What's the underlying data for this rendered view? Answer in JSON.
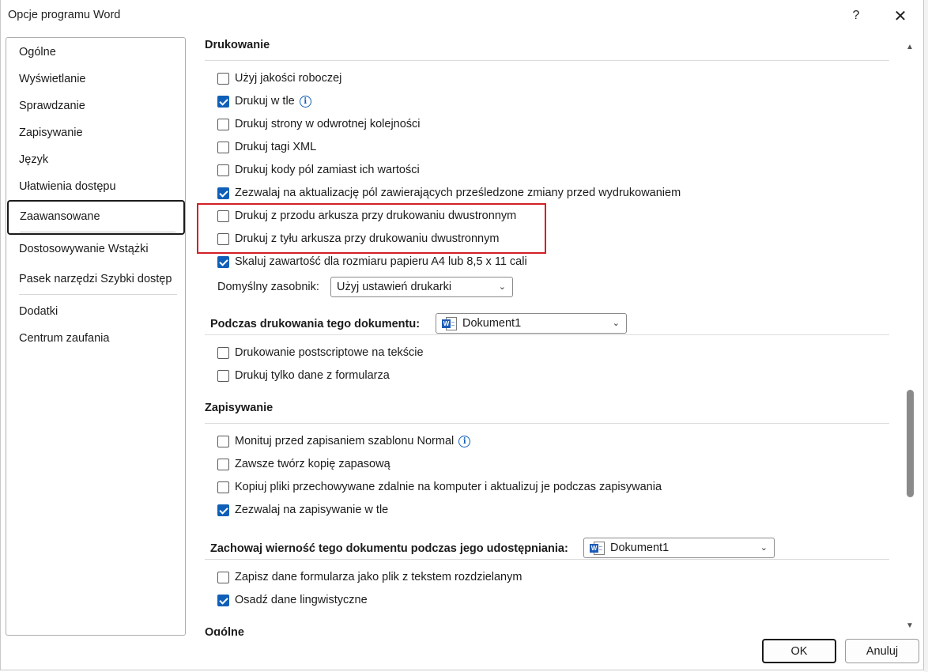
{
  "window": {
    "title": "Opcje programu Word",
    "help_label": "?",
    "close_label": "✕"
  },
  "sidebar": {
    "items": [
      {
        "label": "Ogólne"
      },
      {
        "label": "Wyświetlanie"
      },
      {
        "label": "Sprawdzanie"
      },
      {
        "label": "Zapisywanie"
      },
      {
        "label": "Język"
      },
      {
        "label": "Ułatwienia dostępu"
      },
      {
        "label": "Zaawansowane",
        "selected": true
      },
      {
        "label": "Dostosowywanie Wstążki"
      },
      {
        "label": "Pasek narzędzi Szybki dostęp"
      },
      {
        "label": "Dodatki"
      },
      {
        "label": "Centrum zaufania"
      }
    ]
  },
  "printing": {
    "title": "Drukowanie",
    "options": [
      {
        "label": "Użyj jakości roboczej",
        "checked": false
      },
      {
        "label": "Drukuj w tle",
        "checked": true,
        "info": true
      },
      {
        "label": "Drukuj strony w odwrotnej kolejności",
        "checked": false
      },
      {
        "label": "Drukuj tagi XML",
        "checked": false
      },
      {
        "label": "Drukuj kody pól zamiast ich wartości",
        "checked": false
      },
      {
        "label": "Zezwalaj na aktualizację pól zawierających prześledzone zmiany przed wydrukowaniem",
        "checked": true
      },
      {
        "label": "Drukuj z przodu arkusza przy drukowaniu dwustronnym",
        "checked": false
      },
      {
        "label": "Drukuj z tyłu arkusza przy drukowaniu dwustronnym",
        "checked": false
      },
      {
        "label": "Skaluj zawartość dla rozmiaru papieru A4 lub 8,5 x 11 cali",
        "checked": true
      }
    ],
    "tray_label": "Domyślny zasobnik:",
    "tray_value": "Użyj ustawień drukarki"
  },
  "print_doc": {
    "title": "Podczas drukowania tego dokumentu:",
    "doc_value": "Dokument1",
    "options": [
      {
        "label": "Drukowanie postscriptowe na tekście",
        "checked": false
      },
      {
        "label": "Drukuj tylko dane z formularza",
        "checked": false
      }
    ]
  },
  "saving": {
    "title": "Zapisywanie",
    "options": [
      {
        "label": "Monituj przed zapisaniem szablonu Normal",
        "checked": false,
        "info": true
      },
      {
        "label": "Zawsze twórz kopię zapasową",
        "checked": false
      },
      {
        "label": "Kopiuj pliki przechowywane zdalnie na komputer i aktualizuj je podczas zapisywania",
        "checked": false
      },
      {
        "label": "Zezwalaj na zapisywanie w tle",
        "checked": true
      }
    ]
  },
  "fidelity": {
    "title": "Zachowaj wierność tego dokumentu podczas jego udostępniania:",
    "doc_value": "Dokument1",
    "options": [
      {
        "label": "Zapisz dane formularza jako plik z tekstem rozdzielanym",
        "checked": false
      },
      {
        "label": "Osadź dane lingwistyczne",
        "checked": true
      }
    ]
  },
  "general_cut": {
    "title": "Ogólne"
  },
  "icons": {
    "info": "i",
    "word_badge": "W",
    "chevron": "⌄",
    "scroll_up": "▲",
    "scroll_down": "▼"
  },
  "buttons": {
    "ok": "OK",
    "cancel": "Anuluj"
  },
  "colors": {
    "accent": "#0f5fb8",
    "highlight_border": "#d32027"
  }
}
